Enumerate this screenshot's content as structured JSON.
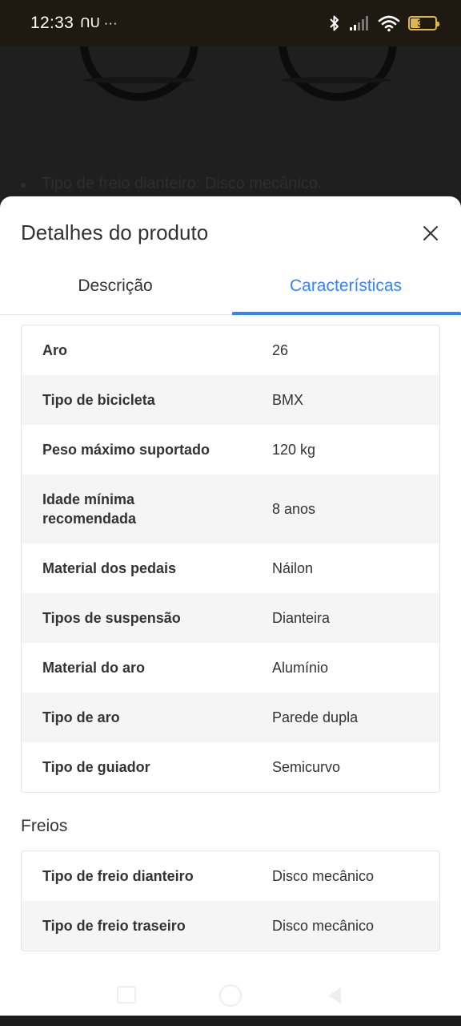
{
  "status_bar": {
    "time": "12:33",
    "extra": "ᑎᑌ ···",
    "battery": "39"
  },
  "background": {
    "text": "Tipo de freio dianteiro: Disco mecânico."
  },
  "sheet": {
    "title": "Detalhes do produto",
    "close_icon": "close-icon",
    "tabs": [
      {
        "label": "Descrição",
        "active": false
      },
      {
        "label": "Características",
        "active": true
      }
    ],
    "accent_color": "#3483fa",
    "specs": [
      {
        "label": "Aro",
        "value": "26"
      },
      {
        "label": "Tipo de bicicleta",
        "value": "BMX"
      },
      {
        "label": "Peso máximo suportado",
        "value": "120 kg"
      },
      {
        "label": "Idade mínima recomendada",
        "value": "8 anos"
      },
      {
        "label": "Material dos pedais",
        "value": "Náilon"
      },
      {
        "label": "Tipos de suspensão",
        "value": "Dianteira"
      },
      {
        "label": "Material do aro",
        "value": "Alumínio"
      },
      {
        "label": "Tipo de aro",
        "value": "Parede dupla"
      },
      {
        "label": "Tipo de guiador",
        "value": "Semicurvo"
      }
    ],
    "brakes_title": "Freios",
    "brakes": [
      {
        "label": "Tipo de freio dianteiro",
        "value": "Disco mecânico"
      },
      {
        "label": "Tipo de freio traseiro",
        "value": "Disco mecânico"
      }
    ]
  }
}
